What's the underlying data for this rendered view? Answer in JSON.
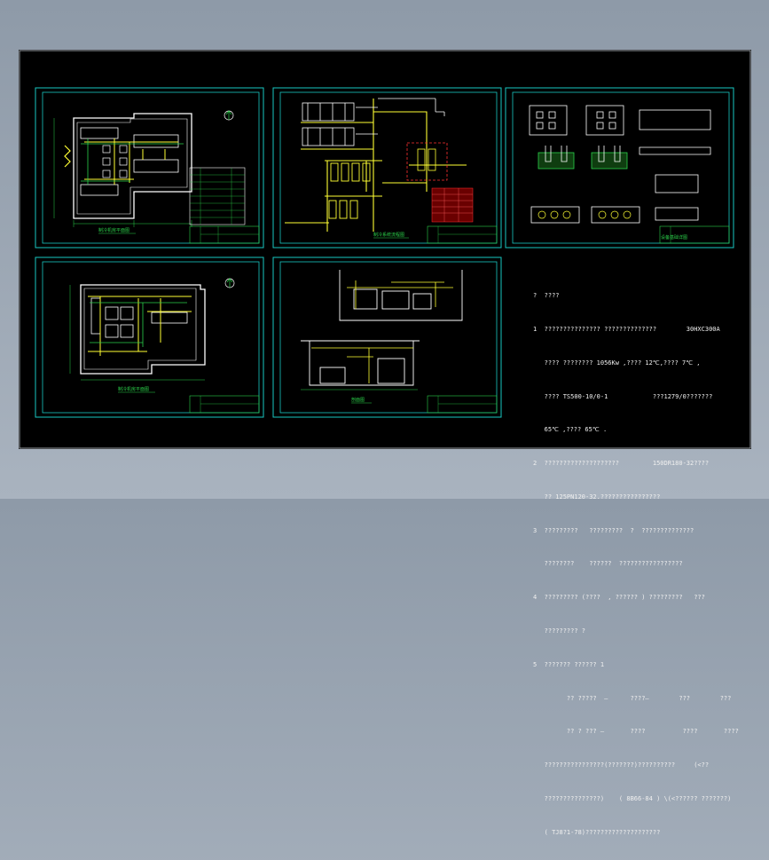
{
  "colors": {
    "frame": "#19c7c2",
    "wall": "#ffffff",
    "pipe": "#ffff33",
    "hot": "#ff3030",
    "green": "#2bd14a",
    "cyan": "#33e0ff",
    "title": "#2bd14a"
  },
  "sheets": [
    {
      "id": "sheet-1",
      "title": "制冷机房平面图"
    },
    {
      "id": "sheet-2",
      "title": "制冷系统流程图"
    },
    {
      "id": "sheet-3",
      "title": "设备基础详图"
    },
    {
      "id": "sheet-4",
      "title": "制冷机房平面图"
    },
    {
      "id": "sheet-5",
      "title": "剖面图"
    }
  ],
  "notes": [
    "?  ????",
    "1  ??????????????? ??????????????        30HXC300A",
    "   ???? ???????? 1056Kw ,???? 12℃,???? 7℃ ,",
    "   ???? TS500-10/0-1            ???1279/0???????",
    "   65℃ ,???? 65℃ .",
    "2  ????????????????????         150DR180-32????",
    "   ?? 125PN120-32.????????????????",
    "3  ?????????   ?????????  ?  ??????????????",
    "   ????????    ??????  ?????????????????",
    "4  ????????? (????  , ?????? ) ?????????   ???",
    "   ????????? ?",
    "5  ??????? ?????? 1",
    "         ?? ?????  —      ????—        ???        ???",
    "         ?? ? ??? —       ????          ????       ????",
    "   ????????????????(???????)??????????     (<??",
    "   ???????????????)    ( 8B66-84 ) \\(<?????? ???????)",
    "   ( TJ8?1-78)????????????????????"
  ]
}
